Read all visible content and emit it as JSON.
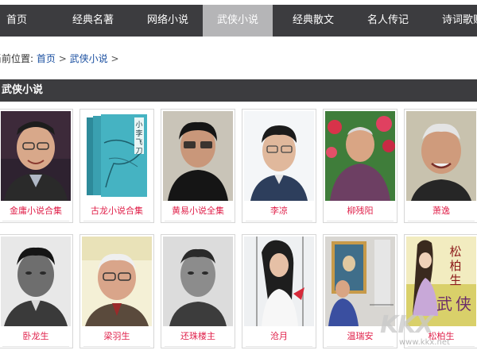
{
  "nav": {
    "items": [
      "首页",
      "经典名著",
      "网络小说",
      "武侠小说",
      "经典散文",
      "名人传记",
      "诗词歌赋"
    ],
    "active_index": 3
  },
  "breadcrumb": {
    "prefix": "当前位置:",
    "home": "首页",
    "current": "武侠小说",
    "separator": ">"
  },
  "section": {
    "title": "武侠小说"
  },
  "cards_row1": [
    {
      "caption": "金庸小说合集",
      "image": "portrait-jin-yong"
    },
    {
      "caption": "古龙小说合集",
      "image": "book-cover-xiaoli-feidao"
    },
    {
      "caption": "黄易小说全集",
      "image": "portrait-huang-yi"
    },
    {
      "caption": "李凉",
      "image": "portrait-li-liang"
    },
    {
      "caption": "柳残阳",
      "image": "portrait-liu-canyang"
    },
    {
      "caption": "萧逸",
      "image": "portrait-xiao-yi"
    }
  ],
  "cards_row2": [
    {
      "caption": "卧龙生",
      "image": "portrait-wo-longsheng"
    },
    {
      "caption": "梁羽生",
      "image": "portrait-liang-yusheng"
    },
    {
      "caption": "还珠楼主",
      "image": "portrait-huanzhu-louzhu"
    },
    {
      "caption": "沧月",
      "image": "portrait-cang-yue"
    },
    {
      "caption": "温瑞安",
      "image": "portrait-wen-ruian"
    },
    {
      "caption": "松柏生",
      "image": "cover-songbaisheng"
    }
  ],
  "watermark": {
    "logo_text": "KKX",
    "url": "www.kkx.net"
  },
  "colors": {
    "nav_bg": "#3c3c3f",
    "nav_active": "#b5b5b7",
    "caption": "#e0204a",
    "link": "#1a4fa0"
  }
}
